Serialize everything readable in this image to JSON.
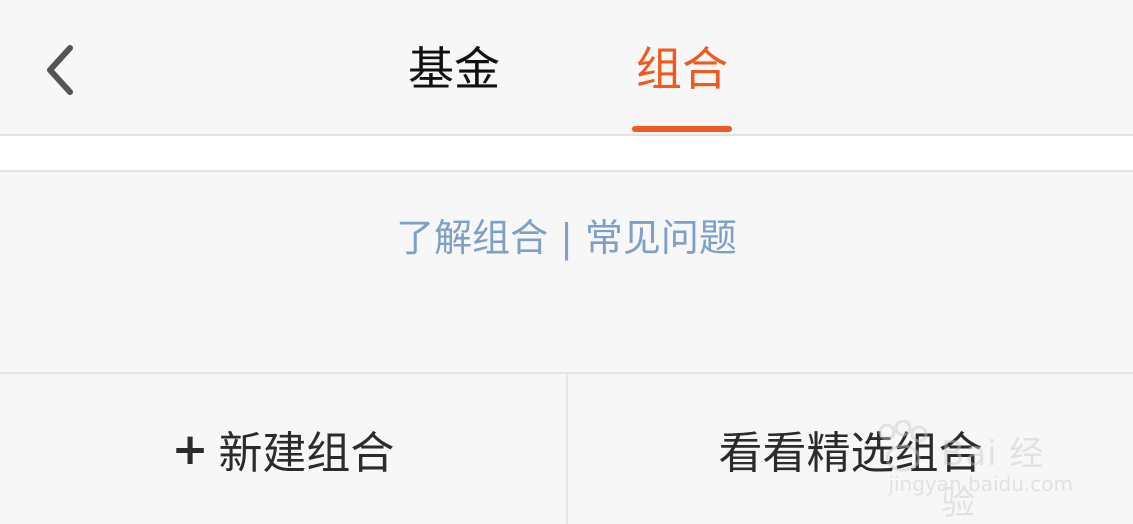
{
  "header": {
    "tabs": [
      {
        "label": "基金",
        "active": false
      },
      {
        "label": "组合",
        "active": true
      }
    ],
    "accent_color": "#ee5a1f",
    "back_icon": "chevron-left-icon"
  },
  "links": {
    "learn": "了解组合",
    "separator": "|",
    "faq": "常见问题",
    "color": "#7f9fc6"
  },
  "actions": {
    "new_plus": "+",
    "new_label": "新建组合",
    "featured_label": "看看精选组合"
  },
  "watermark": {
    "brand": "Bai 经验",
    "url": "jingyan.baidu.com"
  }
}
